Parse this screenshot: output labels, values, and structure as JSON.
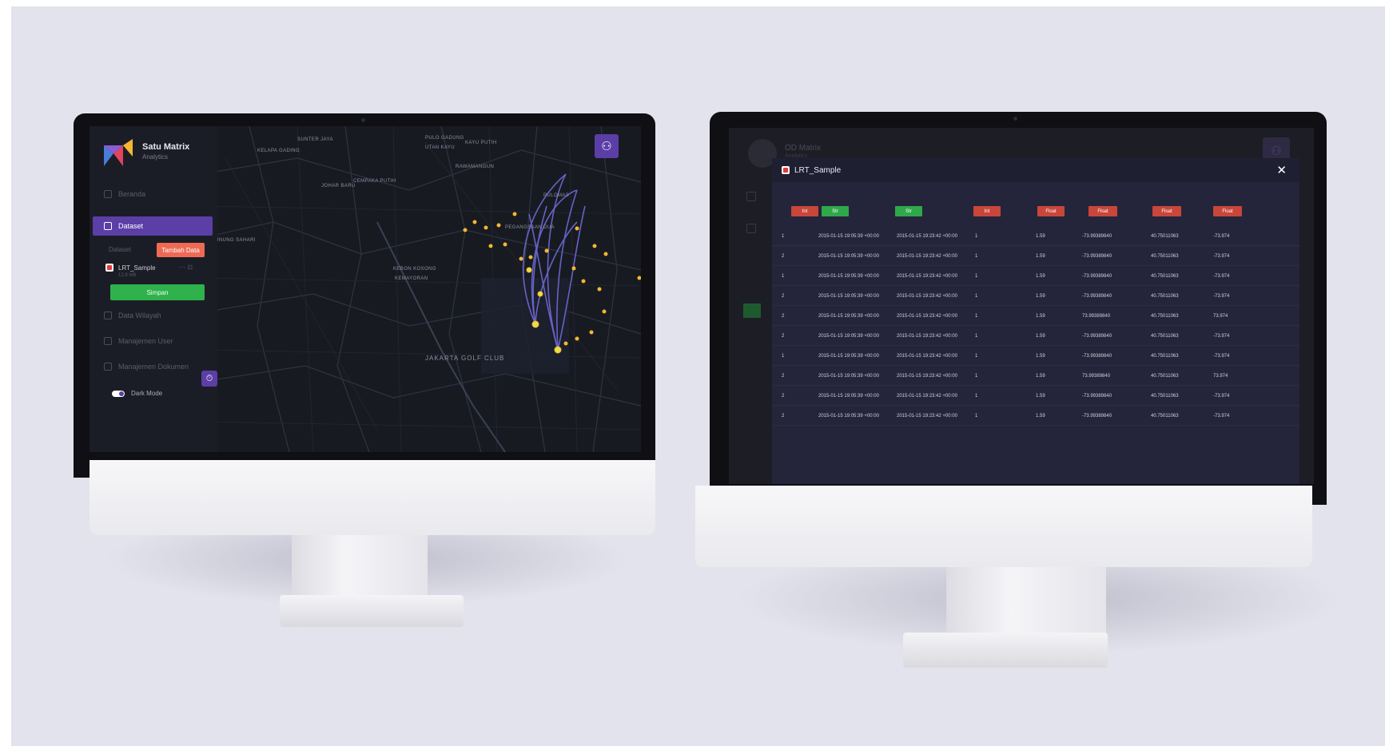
{
  "left_app": {
    "brand": {
      "name": "Satu Matrix",
      "subtitle": "Analytics"
    },
    "sidebar": {
      "items": [
        {
          "label": "Beranda",
          "active": false
        },
        {
          "label": "Dataset",
          "active": true
        },
        {
          "label": "Data Wilayah",
          "active": false
        },
        {
          "label": "Manajemen User",
          "active": false
        },
        {
          "label": "Manajemen Dokumen",
          "active": false
        }
      ],
      "dataset_heading": "Dataset",
      "new_data_button": "Tambah Data",
      "file": {
        "name": "LRT_Sample",
        "meta": "12.8 MB",
        "actions": "⋯  ⊡"
      },
      "green_button": "Simpan",
      "dark_mode_label": "Dark Mode"
    },
    "map": {
      "labels": [
        "KELAPA GADING",
        "SUNTER JAYA",
        "PULO GADUNG",
        "KAYU PUTIH",
        "RAWAMANGUN",
        "JOHAR BARU",
        "CEMPAKA PUTIH",
        "KEBON KOSONG",
        "KEMAYORAN",
        "PULOMAS",
        "PEGANGSAAN DUA",
        "UTAN KAYU",
        "GUNUNG SAHARI"
      ],
      "golf_label": "JAKARTA GOLF CLUB",
      "point_color": "#f5b731",
      "arc_color": "#6d6bd6"
    },
    "accent": "#5b3ea6"
  },
  "right_app": {
    "brand": {
      "name": "OD Matrix",
      "subtitle": "Analytics"
    },
    "modal": {
      "title": "LRT_Sample",
      "close_icon": "close-icon",
      "column_tags": [
        "Int",
        "Str",
        "Str",
        "Int",
        "Float",
        "Float",
        "Float",
        "Float"
      ],
      "rows": [
        [
          "1",
          "2015-01-15 19:05:39 +00:00",
          "2015-01-15 19:23:42 +00:00",
          "1",
          "1.59",
          "-73.99389840",
          "40.75011063",
          "-73.974"
        ],
        [
          "2",
          "2015-01-15 19:05:39 +00:00",
          "2015-01-15 19:23:42 +00:00",
          "1",
          "1.59",
          "-73.99389840",
          "40.75011063",
          "-73.974"
        ],
        [
          "1",
          "2015-01-15 19:05:39 +00:00",
          "2015-01-15 19:23:42 +00:00",
          "1",
          "1.59",
          "-73.99389840",
          "40.75011063",
          "-73.974"
        ],
        [
          "2",
          "2015-01-15 19:05:39 +00:00",
          "2015-01-15 19:23:42 +00:00",
          "1",
          "1.59",
          "-73.99389840",
          "40.75011063",
          "-73.974"
        ],
        [
          "2",
          "2015-01-15 19:05:39 +00:00",
          "2015-01-15 19:23:42 +00:00",
          "1",
          "1.59",
          "73.99389840",
          "40.75011063",
          "73.974"
        ],
        [
          "2",
          "2015-01-15 19:05:39 +00:00",
          "2015-01-15 19:23:42 +00:00",
          "1",
          "1.59",
          "-73.99389840",
          "40.75011063",
          "-73.974"
        ],
        [
          "1",
          "2015-01-15 19:05:39 +00:00",
          "2015-01-15 19:23:42 +00:00",
          "1",
          "1.59",
          "-73.99389840",
          "40.75011063",
          "-73.974"
        ],
        [
          "2",
          "2015-01-15 19:05:39 +00:00",
          "2015-01-15 19:23:42 +00:00",
          "1",
          "1.59",
          "73.99389840",
          "40.75011063",
          "73.974"
        ],
        [
          "2",
          "2015-01-15 19:05:39 +00:00",
          "2015-01-15 19:23:42 +00:00",
          "1",
          "1.59",
          "-73.99389840",
          "40.75011063",
          "-73.974"
        ],
        [
          "2",
          "2015-01-15 19:05:39 +00:00",
          "2015-01-15 19:23:42 +00:00",
          "1",
          "1.59",
          "-73.99389840",
          "40.75011063",
          "-73.974"
        ]
      ]
    }
  }
}
